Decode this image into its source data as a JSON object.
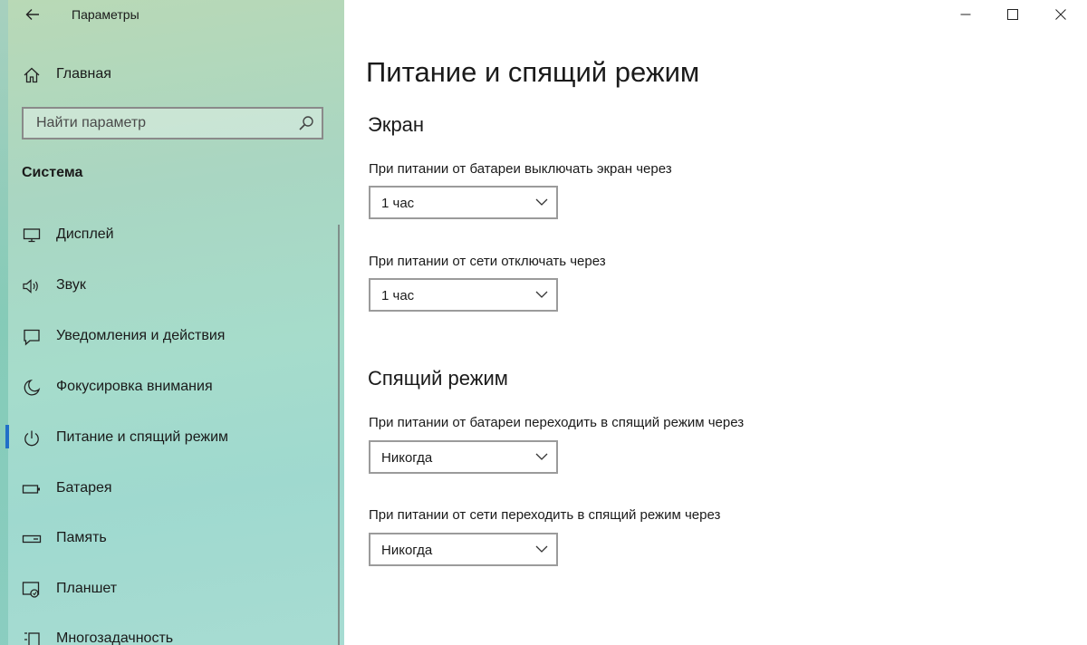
{
  "window": {
    "title": "Параметры"
  },
  "sidebar": {
    "home_label": "Главная",
    "search": {
      "placeholder": "Найти параметр",
      "value": ""
    },
    "section_title": "Система",
    "items": [
      {
        "label": "Дисплей",
        "icon": "monitor-icon"
      },
      {
        "label": "Звук",
        "icon": "speaker-icon"
      },
      {
        "label": "Уведомления и действия",
        "icon": "notification-icon"
      },
      {
        "label": "Фокусировка внимания",
        "icon": "moon-icon"
      },
      {
        "label": "Питание и спящий режим",
        "icon": "power-icon",
        "selected": true
      },
      {
        "label": "Батарея",
        "icon": "battery-icon"
      },
      {
        "label": "Память",
        "icon": "storage-icon"
      },
      {
        "label": "Планшет",
        "icon": "tablet-icon"
      },
      {
        "label": "Многозадачность",
        "icon": "multitasking-icon"
      }
    ]
  },
  "main": {
    "title": "Питание и спящий режим",
    "screen": {
      "heading": "Экран",
      "battery_label": "При питании от батареи выключать экран через",
      "battery_value": "1 час",
      "plugged_label": "При питании от сети отключать через",
      "plugged_value": "1 час"
    },
    "sleep": {
      "heading": "Спящий режим",
      "battery_label": "При питании от батареи переходить в спящий режим через",
      "battery_value": "Никогда",
      "plugged_label": "При питании от сети переходить в спящий режим через",
      "plugged_value": "Никогда"
    }
  },
  "colors": {
    "accent": "#1f6fc8",
    "sidebar_top": "#b9d9b6",
    "sidebar_bottom": "#a7dcd2",
    "dropdown_border": "#9b9b9b"
  }
}
